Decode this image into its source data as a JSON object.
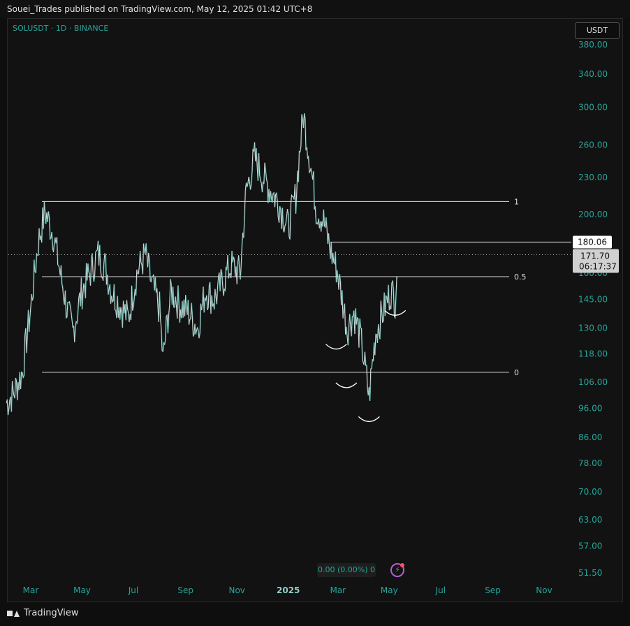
{
  "header": {
    "publish_line": "Souei_Trades published on TradingView.com, May 12, 2025 01:42 UTC+8"
  },
  "legend": {
    "symbol_line": "SOLUSDT · 1D · BINANCE"
  },
  "currency_button": "USDT",
  "footer": {
    "brand": "TradingView"
  },
  "change_readout": "0.00 (0.00%) 0",
  "colors": {
    "up": "#26a69a",
    "down": "#ef5350",
    "lines": "#ffffff",
    "background": "#121212"
  },
  "chart_data": {
    "type": "line",
    "symbol": "SOLUSDT",
    "timeframe": "1D",
    "exchange": "BINANCE",
    "log_scale": true,
    "ylim": [
      50,
      400
    ],
    "x_ticks": [
      "Mar",
      "May",
      "Jul",
      "Sep",
      "Nov",
      "2025",
      "Mar",
      "May",
      "Jul",
      "Sep",
      "Nov"
    ],
    "y_ticks": [
      "380.00",
      "340.00",
      "300.00",
      "260.00",
      "230.00",
      "200.00",
      "160.00",
      "145.00",
      "130.00",
      "118.00",
      "106.00",
      "96.00",
      "86.00",
      "78.00",
      "70.00",
      "63.00",
      "57.00",
      "51.50"
    ],
    "price_series": {
      "dates": [
        "2024-02-01",
        "2024-02-10",
        "2024-02-20",
        "2024-03-01",
        "2024-03-10",
        "2024-03-18",
        "2024-03-28",
        "2024-04-05",
        "2024-04-13",
        "2024-04-20",
        "2024-05-01",
        "2024-05-10",
        "2024-05-20",
        "2024-05-28",
        "2024-06-05",
        "2024-06-15",
        "2024-06-25",
        "2024-07-05",
        "2024-07-15",
        "2024-07-22",
        "2024-08-01",
        "2024-08-05",
        "2024-08-15",
        "2024-08-25",
        "2024-09-05",
        "2024-09-15",
        "2024-09-25",
        "2024-10-05",
        "2024-10-15",
        "2024-10-25",
        "2024-11-05",
        "2024-11-12",
        "2024-11-22",
        "2024-12-01",
        "2024-12-10",
        "2024-12-20",
        "2025-01-01",
        "2025-01-10",
        "2025-01-19",
        "2025-01-25",
        "2025-02-03",
        "2025-02-12",
        "2025-02-20",
        "2025-02-28",
        "2025-03-05",
        "2025-03-12",
        "2025-03-20",
        "2025-03-28",
        "2025-04-07",
        "2025-04-15",
        "2025-04-25",
        "2025-05-03",
        "2025-05-08",
        "2025-05-11"
      ],
      "values": [
        98,
        102,
        110,
        140,
        180,
        202,
        185,
        160,
        140,
        128,
        150,
        160,
        172,
        165,
        150,
        142,
        135,
        160,
        172,
        155,
        140,
        115,
        150,
        142,
        138,
        130,
        150,
        145,
        155,
        165,
        160,
        218,
        248,
        232,
        220,
        210,
        190,
        215,
        292,
        255,
        205,
        195,
        175,
        162,
        148,
        130,
        138,
        125,
        100,
        128,
        140,
        150,
        145,
        172
      ]
    },
    "horizontal_levels": [
      {
        "label": "1",
        "value": 210
      },
      {
        "label": "0.5",
        "value": 158
      },
      {
        "label": "0",
        "value": 110
      }
    ],
    "resistance_line": {
      "value": 180.06
    },
    "last_price": 171.7,
    "last_price_label": "171.70",
    "countdown": "06:17:37",
    "resistance_label": "180.06",
    "annotations": [
      {
        "shape": "arc",
        "date": "2025-02-27",
        "value": 125
      },
      {
        "shape": "arc",
        "date": "2025-03-11",
        "value": 108
      },
      {
        "shape": "arc",
        "date": "2025-04-07",
        "value": 95
      },
      {
        "shape": "arc",
        "date": "2025-05-08",
        "value": 142
      }
    ]
  }
}
